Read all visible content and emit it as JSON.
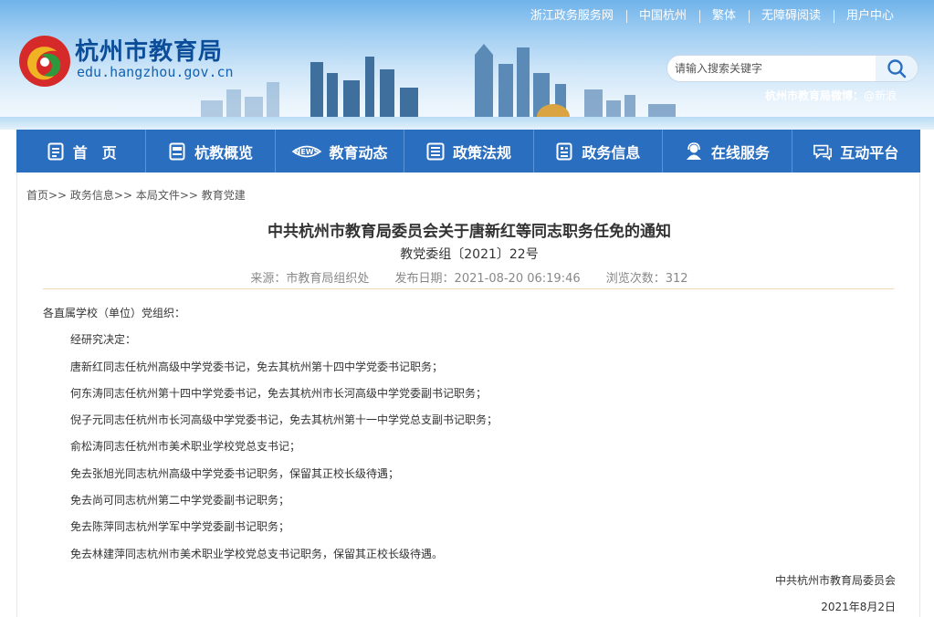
{
  "topbar": {
    "links": [
      "浙江政务服务网",
      "中国杭州",
      "繁体",
      "无障碍阅读",
      "用户中心"
    ]
  },
  "site": {
    "name": "杭州市教育局",
    "domain": "edu.hangzhou.gov.cn",
    "weibo_label": "杭州市教育局微博：",
    "weibo_link": "@新浪"
  },
  "search": {
    "placeholder": "请输入搜索关键字",
    "icon": "search-icon"
  },
  "nav": {
    "items": [
      {
        "label": "首　页",
        "icon": "document-icon"
      },
      {
        "label": "杭教概览",
        "icon": "book-icon"
      },
      {
        "label": "教育动态",
        "icon": "news-icon"
      },
      {
        "label": "政策法规",
        "icon": "list-icon"
      },
      {
        "label": "政务信息",
        "icon": "info-icon"
      },
      {
        "label": "在线服务",
        "icon": "user-service-icon"
      },
      {
        "label": "互动平台",
        "icon": "chat-icon"
      }
    ]
  },
  "breadcrumb": "首页>> 政务信息>> 本局文件>> 教育党建",
  "article": {
    "title": "中共杭州市教育局委员会关于唐新红等同志职务任免的通知",
    "doc_no": "教党委组〔2021〕22号",
    "source": "来源：市教育局组织处",
    "publish": "发布日期：2021-08-20 06:19:46",
    "views": "浏览次数：312",
    "salutation": "各直属学校（单位）党组织：",
    "paragraphs": [
      "经研究决定：",
      "唐新红同志任杭州高级中学党委书记，免去其杭州第十四中学党委书记职务；",
      "何东涛同志任杭州第十四中学党委书记，免去其杭州市长河高级中学党委副书记职务；",
      "倪子元同志任杭州市长河高级中学党委书记，免去其杭州第十一中学党总支副书记职务；",
      "俞松涛同志任杭州市美术职业学校党总支书记；",
      "免去张旭光同志杭州高级中学党委书记职务，保留其正校长级待遇；",
      "免去尚可同志杭州第二中学党委副书记职务；",
      "免去陈萍同志杭州学军中学党委副书记职务；",
      "免去林建萍同志杭州市美术职业学校党总支书记职务，保留其正校长级待遇。"
    ],
    "signature": "中共杭州市教育局委员会",
    "date": "2021年8月2日"
  },
  "colors": {
    "nav_bg": "#2a6ec0",
    "logo_blue": "#0c4d9a",
    "divider": "#f0d8b8"
  }
}
